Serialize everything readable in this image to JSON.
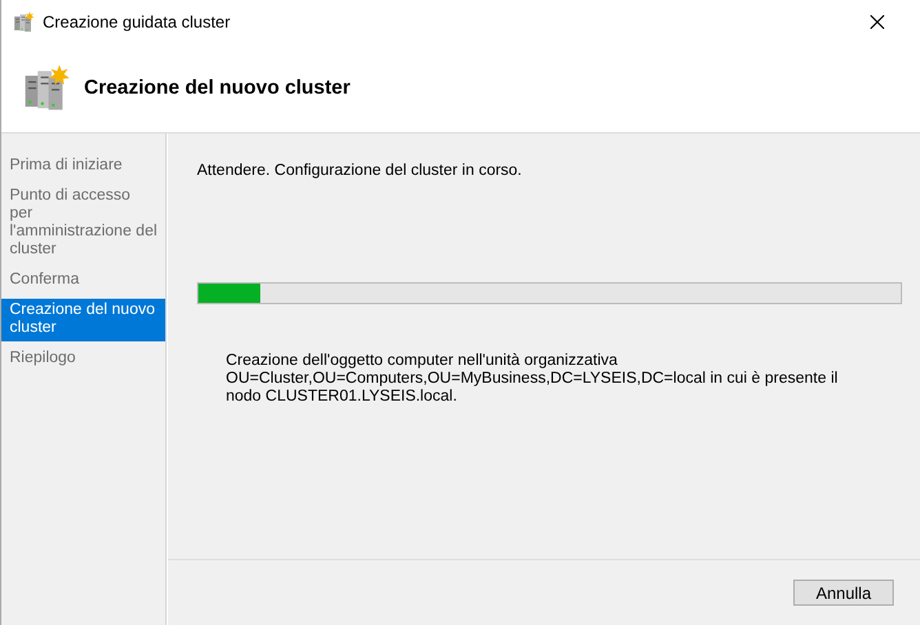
{
  "window": {
    "title": "Creazione guidata cluster"
  },
  "header": {
    "title": "Creazione del nuovo cluster"
  },
  "sidebar": {
    "items": [
      {
        "label": "Prima di iniziare",
        "selected": false
      },
      {
        "label": "Punto di accesso per l'amministrazione del cluster",
        "selected": false
      },
      {
        "label": "Conferma",
        "selected": false
      },
      {
        "label": "Creazione del nuovo cluster",
        "selected": true
      },
      {
        "label": "Riepilogo",
        "selected": false
      }
    ]
  },
  "content": {
    "message": "Attendere. Configurazione del cluster in corso.",
    "progress": {
      "level": 0.088
    },
    "status": "Creazione dell'oggetto computer nell'unità organizzativa OU=Cluster,OU=Computers,OU=MyBusiness,DC=LYSEIS,DC=local in cui è presente il nodo CLUSTER01.LYSEIS.local."
  },
  "buttons": [
    {
      "label": "Annulla"
    }
  ]
}
